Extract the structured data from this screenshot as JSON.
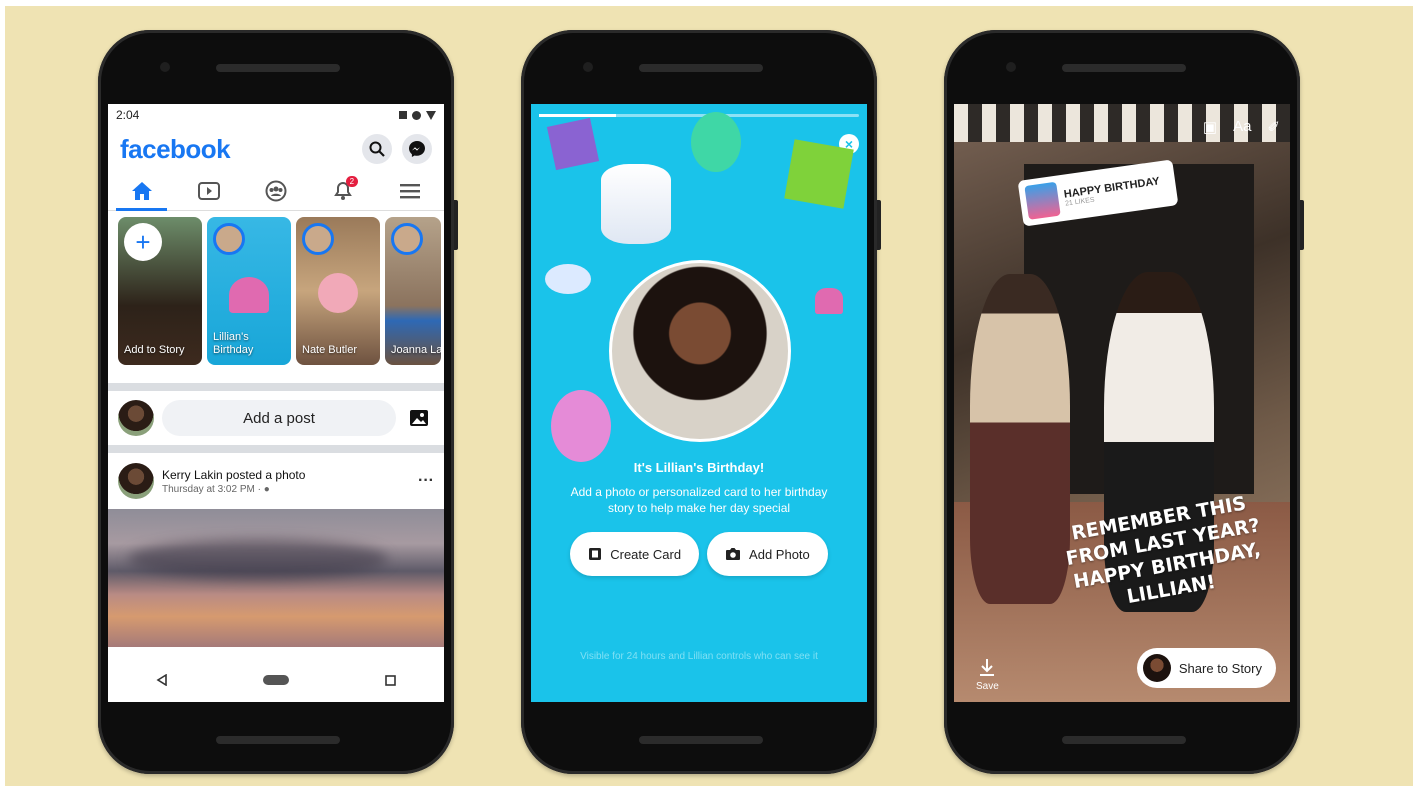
{
  "phone1": {
    "status_time": "2:04",
    "logo": "facebook",
    "search_icon": "search-icon",
    "messenger_icon": "messenger-icon",
    "tabs": [
      {
        "icon": "home-icon",
        "active": true
      },
      {
        "icon": "watch-icon",
        "active": false
      },
      {
        "icon": "groups-icon",
        "active": false
      },
      {
        "icon": "notifications-icon",
        "active": false,
        "badge": "2"
      },
      {
        "icon": "menu-icon",
        "active": false
      }
    ],
    "stories": [
      {
        "label": "Add to Story"
      },
      {
        "label": "Lillian's Birthday"
      },
      {
        "label": "Nate Butler"
      },
      {
        "label": "Joanna Lam"
      }
    ],
    "composer_placeholder": "Add a post",
    "post": {
      "author_line": "Kerry Lakin posted a photo",
      "time": "Thursday at 3:02 PM · ",
      "more": "···"
    }
  },
  "phone2": {
    "title": "It's Lillian's Birthday!",
    "body": "Add a photo or personalized card to her birthday story to help make her day special",
    "create_card": "Create Card",
    "add_photo": "Add Photo",
    "footnote": "Visible for 24 hours and Lillian controls who can see it",
    "close": "×"
  },
  "phone3": {
    "sticker_title": "HAPPY BIRTHDAY",
    "sticker_sub": "21 LIKES",
    "tool_text": "Aa",
    "overlay_text": "REMEMBER THIS FROM LAST YEAR? HAPPY BIRTHDAY, LILLIAN!",
    "save_label": "Save",
    "share_label": "Share to Story"
  },
  "colors": {
    "background": "#efe3b3",
    "facebook_blue": "#1877f2",
    "birthday_cyan": "#1ac3ea"
  }
}
